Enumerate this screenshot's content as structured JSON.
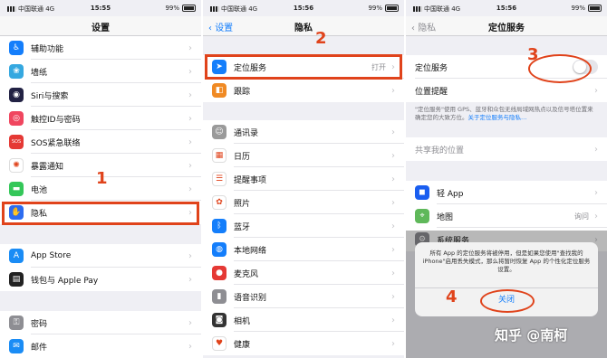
{
  "colors": {
    "accent": "#147efb",
    "annotation_red": "#e0431b",
    "toggle_off": "#e5e5ea"
  },
  "panel1": {
    "status": {
      "carrier": "中国联通 4G",
      "time": "15:55",
      "battery": "99%"
    },
    "nav_title": "设置",
    "items": [
      {
        "label": "辅助功能",
        "icon": "accessibility-icon",
        "color": "#147efb",
        "glyph": "♿"
      },
      {
        "label": "墙纸",
        "icon": "wallpaper-icon",
        "color": "#35a8e0",
        "glyph": "❀"
      },
      {
        "label": "Siri与搜索",
        "icon": "siri-icon",
        "color": "#222244",
        "glyph": "◉"
      },
      {
        "label": "触控ID与密码",
        "icon": "fingerprint-icon",
        "color": "#f0465f",
        "glyph": "◎"
      },
      {
        "label": "SOS紧急联络",
        "icon": "sos-icon",
        "color": "#e53935",
        "glyph": "SOS"
      },
      {
        "label": "暴露通知",
        "icon": "exposure-icon",
        "color": "#ffffff",
        "glyph": "✺"
      },
      {
        "label": "电池",
        "icon": "battery-icon",
        "color": "#34c759",
        "glyph": "▬"
      },
      {
        "label": "隐私",
        "icon": "privacy-hand-icon",
        "color": "#2c6cf0",
        "glyph": "✋"
      }
    ],
    "items2": [
      {
        "label": "App Store",
        "icon": "app-store-icon",
        "color": "#1a8cf5",
        "glyph": "A"
      },
      {
        "label": "钱包与 Apple Pay",
        "icon": "wallet-icon",
        "color": "#222222",
        "glyph": "▤"
      }
    ],
    "items3": [
      {
        "label": "密码",
        "icon": "key-icon",
        "color": "#8e8e93",
        "glyph": "⚿"
      },
      {
        "label": "邮件",
        "icon": "mail-icon",
        "color": "#1a8cf5",
        "glyph": "✉"
      }
    ],
    "step": "1"
  },
  "panel2": {
    "status": {
      "carrier": "中国联通 4G",
      "time": "15:56",
      "battery": "99%"
    },
    "nav_back": "设置",
    "nav_title": "隐私",
    "items": [
      {
        "label": "定位服务",
        "value": "打开",
        "icon": "location-arrow-icon",
        "color": "#147efb",
        "glyph": "➤"
      },
      {
        "label": "跟踪",
        "value": "",
        "icon": "tracking-icon",
        "color": "#f08a24",
        "glyph": "◧"
      }
    ],
    "items2": [
      {
        "label": "通讯录",
        "icon": "contacts-icon",
        "color": "#9a9a9a",
        "glyph": "☺"
      },
      {
        "label": "日历",
        "icon": "calendar-icon",
        "color": "#ffffff",
        "glyph": "▦"
      },
      {
        "label": "提醒事项",
        "icon": "reminders-icon",
        "color": "#ffffff",
        "glyph": "☰"
      },
      {
        "label": "照片",
        "icon": "photos-icon",
        "color": "#ffffff",
        "glyph": "✿"
      },
      {
        "label": "蓝牙",
        "icon": "bluetooth-icon",
        "color": "#147efb",
        "glyph": "ᛒ"
      },
      {
        "label": "本地网络",
        "icon": "globe-icon",
        "color": "#147efb",
        "glyph": "◍"
      },
      {
        "label": "麦克风",
        "icon": "microphone-icon",
        "color": "#e53935",
        "glyph": "●"
      },
      {
        "label": "语音识别",
        "icon": "speech-icon",
        "color": "#8e8e93",
        "glyph": "▮"
      },
      {
        "label": "相机",
        "icon": "camera-icon",
        "color": "#333333",
        "glyph": "◙"
      },
      {
        "label": "健康",
        "icon": "health-icon",
        "color": "#ffffff",
        "glyph": "♥"
      }
    ],
    "step": "2"
  },
  "panel3": {
    "status": {
      "carrier": "中国联通 4G",
      "time": "15:56",
      "battery": "99%"
    },
    "nav_back": "隐私",
    "nav_title": "定位服务",
    "location_label": "定位服务",
    "location_alerts": "位置提醒",
    "note": "\"定位服务\"使用 GPS、蓝牙和众包无线局域网热点以及信号塔位置来确定您的大致方位。",
    "note_link": "关于定位服务与隐私…",
    "share_label": "共享我的位置",
    "apps": [
      {
        "label": "轻 App",
        "value": "",
        "icon": "light-app-icon",
        "color": "#1a5ef0",
        "glyph": "◼"
      },
      {
        "label": "地图",
        "value": "询问",
        "icon": "maps-icon",
        "color": "#5fb85a",
        "glyph": "⌖"
      },
      {
        "label": "系统服务",
        "value": "",
        "icon": "gear-icon",
        "color": "#8e8e93",
        "glyph": "⚙"
      }
    ],
    "alert_message": "所有 App 的定位服务将被停用，但是如果您使用\"查找我的 iPhone\"启用丢失模式，那么将暂时恢复 App 的个性化定位服务设置。",
    "alert_button": "关闭",
    "step3": "3",
    "step4": "4"
  },
  "watermark": "知乎 @南柯"
}
